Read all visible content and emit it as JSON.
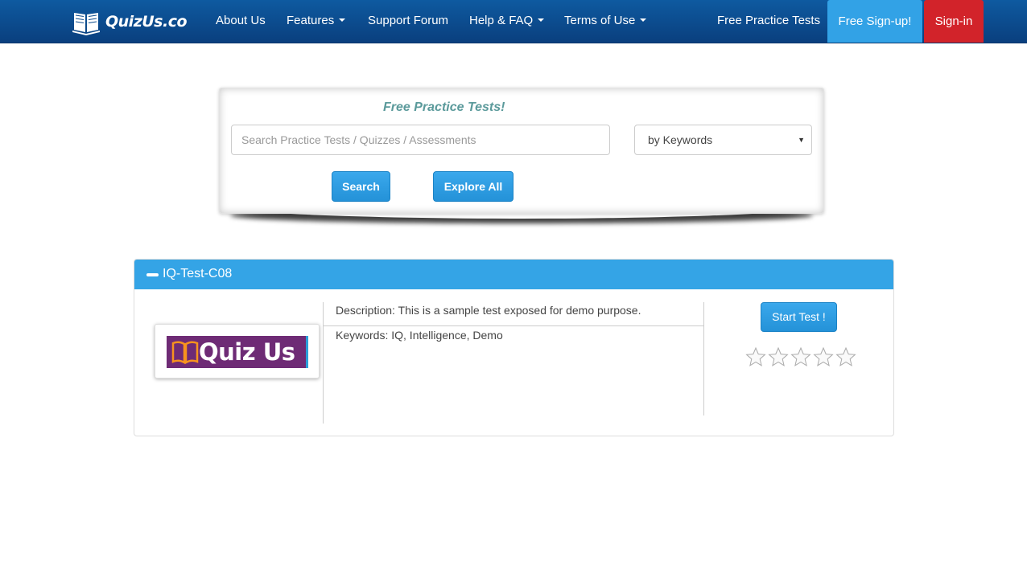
{
  "navbar": {
    "brand": "QuizUs.co",
    "items": [
      {
        "label": "About Us",
        "dropdown": false
      },
      {
        "label": "Features",
        "dropdown": true
      },
      {
        "label": "Support Forum",
        "dropdown": false
      },
      {
        "label": "Help & FAQ",
        "dropdown": true
      },
      {
        "label": "Terms of Use",
        "dropdown": true
      }
    ],
    "free_practice": "Free Practice Tests",
    "signup": "Free Sign-up!",
    "signin": "Sign-in"
  },
  "search": {
    "title": "Free Practice Tests!",
    "placeholder": "Search Practice Tests / Quizzes / Assessments",
    "select_value": "by Keywords",
    "search_button": "Search",
    "explore_button": "Explore All"
  },
  "test": {
    "title": "IQ-Test-C08",
    "thumbnail_text": "Quiz Us",
    "description": "Description: This is a sample test exposed for demo purpose.",
    "keywords": "Keywords: IQ, Intelligence, Demo",
    "start_button": "Start Test !",
    "rating": {
      "value": 0,
      "max": 5
    }
  },
  "colors": {
    "navbar": "#0a4a8c",
    "accent": "#34a4e6",
    "signin": "#d2232a",
    "title_teal": "#5b9a9b"
  }
}
